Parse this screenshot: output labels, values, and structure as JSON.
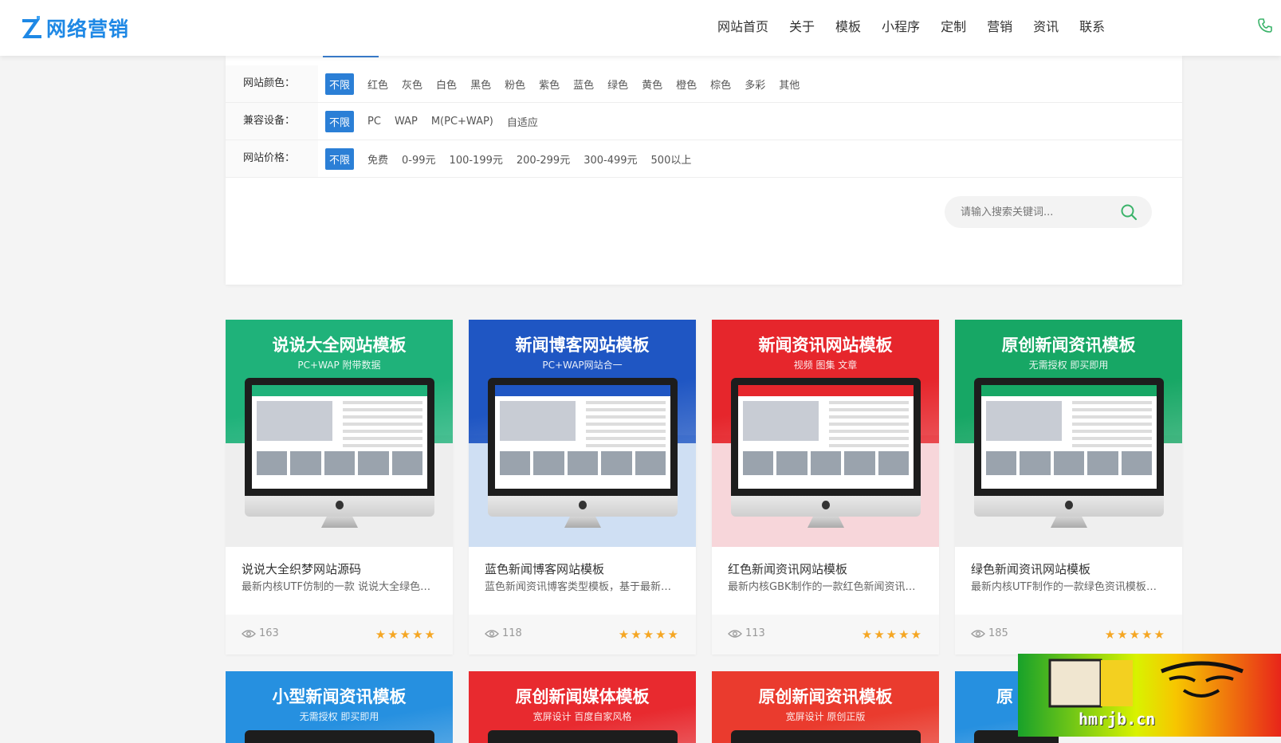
{
  "header": {
    "logo_text": "网络营销",
    "nav": [
      "网站首页",
      "关于",
      "模板",
      "小程序",
      "定制",
      "营销",
      "资讯",
      "联系"
    ]
  },
  "filters": {
    "rows": [
      {
        "label": "网站颜色：",
        "options": [
          "不限",
          "红色",
          "灰色",
          "白色",
          "黑色",
          "粉色",
          "紫色",
          "蓝色",
          "绿色",
          "黄色",
          "橙色",
          "棕色",
          "多彩",
          "其他"
        ],
        "active": 0
      },
      {
        "label": "兼容设备：",
        "options": [
          "不限",
          "PC",
          "WAP",
          "M(PC+WAP)",
          "自适应"
        ],
        "active": 0
      },
      {
        "label": "网站价格：",
        "options": [
          "不限",
          "免费",
          "0-99元",
          "100-199元",
          "200-299元",
          "300-499元",
          "500以上"
        ],
        "active": 0
      }
    ],
    "search_placeholder": "请输入搜索关键词..."
  },
  "cards": [
    {
      "thumb_title": "说说大全网站模板",
      "thumb_sub": "PC+WAP 附带数据",
      "name": "说说大全织梦网站源码",
      "desc": "最新内核UTF仿制的一款 说说大全绿色网站模板",
      "views": "163",
      "stars": "★★★★★",
      "top_color": "#1fb27a",
      "bot_color": "#eeeeee"
    },
    {
      "thumb_title": "新闻博客网站模板",
      "thumb_sub": "PC+WAP网站合一",
      "name": "蓝色新闻博客网站模板",
      "desc": "蓝色新闻资讯博客类型模板，基于最新内核制作",
      "views": "118",
      "stars": "★★★★★",
      "top_color": "#1f56c3",
      "bot_color": "#cfdff3"
    },
    {
      "thumb_title": "新闻资讯网站模板",
      "thumb_sub": "视频 图集 文章",
      "name": "红色新闻资讯网站模板",
      "desc": "最新内核GBK制作的一款红色新闻资讯网站模板",
      "views": "113",
      "stars": "★★★★★",
      "top_color": "#e6262c",
      "bot_color": "#f7d6da"
    },
    {
      "thumb_title": "原创新闻资讯模板",
      "thumb_sub": "无需授权 即买即用",
      "name": "绿色新闻资讯网站模板",
      "desc": "最新内核UTF制作的一款绿色资讯模板网站",
      "views": "185",
      "stars": "★★★★★",
      "top_color": "#17a765",
      "bot_color": "#efefef"
    }
  ],
  "cards_row2": [
    {
      "thumb_title": "小型新闻资讯模板",
      "thumb_sub": "无需授权 即买即用",
      "top_color": "#2690e0"
    },
    {
      "thumb_title": "原创新闻媒体模板",
      "thumb_sub": "宽屏设计 百度自家风格",
      "top_color": "#e82a2f"
    },
    {
      "thumb_title": "原创新闻资讯模板",
      "thumb_sub": "宽屏设计 原创正版",
      "top_color": "#ea3b2e"
    },
    {
      "thumb_title": "原",
      "thumb_sub": "",
      "top_color": "#2690e0"
    }
  ],
  "watermark": {
    "text": "hmrjb.cn"
  }
}
